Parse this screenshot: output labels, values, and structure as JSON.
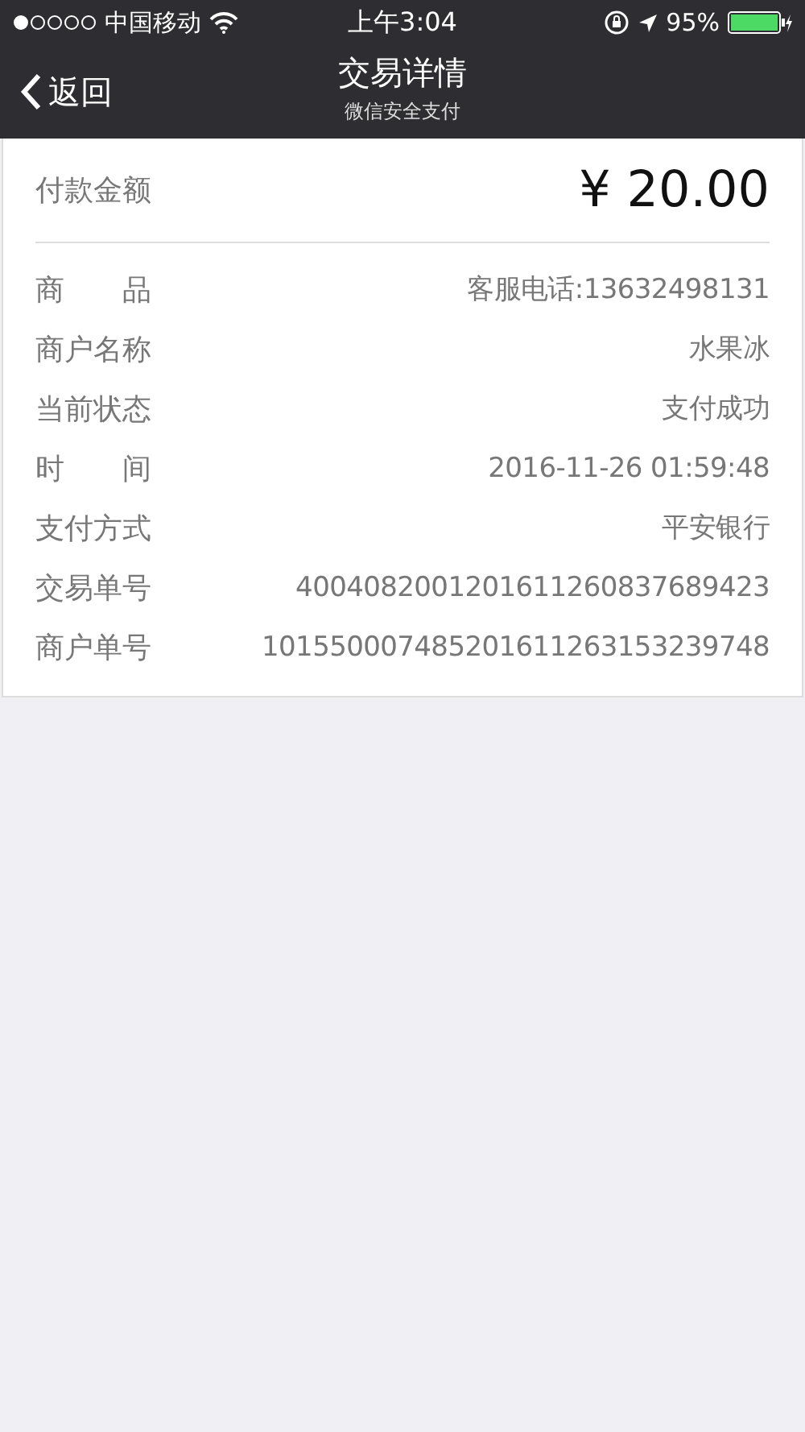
{
  "status_bar": {
    "carrier": "中国移动",
    "time": "上午3:04",
    "battery": "95%"
  },
  "nav": {
    "back": "返回",
    "title": "交易详情",
    "subtitle": "微信安全支付"
  },
  "amount": {
    "label": "付款金额",
    "value": "¥ 20.00"
  },
  "details": [
    {
      "label": "商　　品",
      "value": "客服电话:13632498131"
    },
    {
      "label": "商户名称",
      "value": "水果冰"
    },
    {
      "label": "当前状态",
      "value": "支付成功"
    },
    {
      "label": "时　　间",
      "value": "2016-11-26 01:59:48"
    },
    {
      "label": "支付方式",
      "value": "平安银行"
    },
    {
      "label": "交易单号",
      "value": "4004082001201611260837689423"
    },
    {
      "label": "商户单号",
      "value": "101550007485201611263153239748"
    }
  ]
}
